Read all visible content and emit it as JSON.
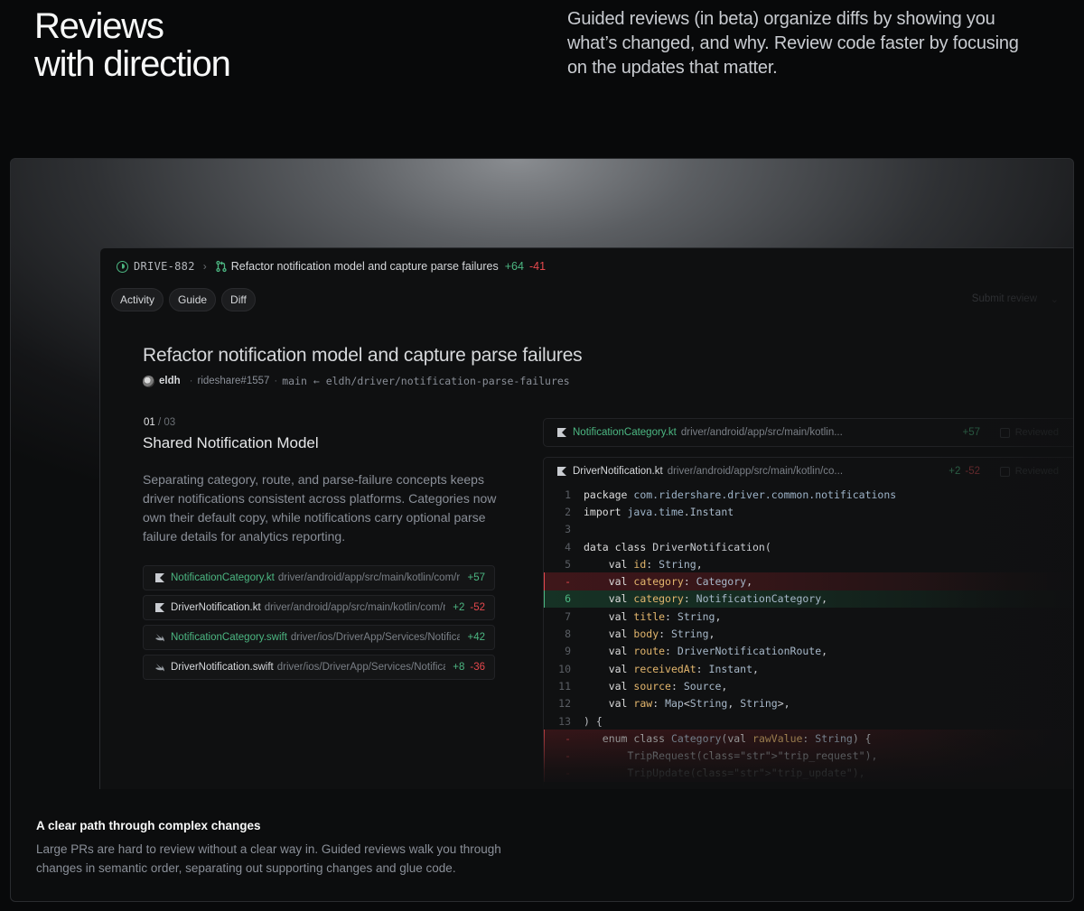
{
  "hero": {
    "title_line1": "Reviews",
    "title_line2": "with direction",
    "description": "Guided reviews (in beta) organize diffs by showing you what’s changed, and why. Review code faster by focusing on the updates that matter."
  },
  "app": {
    "topbar": {
      "issue_id": "DRIVE-882",
      "pr_title": "Refactor notification model and capture parse failures",
      "additions": "+64",
      "deletions": "-41"
    },
    "tabs": [
      "Activity",
      "Guide",
      "Diff"
    ],
    "submit_label": "Submit review",
    "heading": "Refactor notification model and capture parse failures",
    "meta": {
      "author": "eldh",
      "repo_ref": "rideshare#1557",
      "branch": "main ← eldh/driver/notification-parse-failures"
    },
    "step": {
      "current": "01",
      "total": "/ 03",
      "title": "Shared Notification Model",
      "description": "Separating category, route, and parse-failure concepts keeps driver notifications consistent across platforms. Categories now own their default copy, while notifications carry optional parse failure details for analytics reporting."
    },
    "files": [
      {
        "name": "NotificationCategory.kt",
        "path": "driver/android/app/src/main/kotlin/com/ridershare/driver/common/notifications",
        "add": "+57",
        "del": "",
        "new": true,
        "lang": "kotlin"
      },
      {
        "name": "DriverNotification.kt",
        "path": "driver/android/app/src/main/kotlin/com/ridershare/driver/common/notifications",
        "add": "+2",
        "del": "-52",
        "new": false,
        "lang": "kotlin"
      },
      {
        "name": "NotificationCategory.swift",
        "path": "driver/ios/DriverApp/Services/Notifications",
        "add": "+42",
        "del": "",
        "new": true,
        "lang": "swift"
      },
      {
        "name": "DriverNotification.swift",
        "path": "driver/ios/DriverApp/Services/Notifications",
        "add": "+8",
        "del": "-36",
        "new": false,
        "lang": "swift"
      }
    ],
    "panels": [
      {
        "name": "NotificationCategory.kt",
        "path": "driver/android/app/src/main/kotlin...",
        "add": "+57",
        "del": "",
        "reviewed_label": "Reviewed",
        "new": true
      },
      {
        "name": "DriverNotification.kt",
        "path": "driver/android/app/src/main/kotlin/co...",
        "add": "+2",
        "del": "-52",
        "reviewed_label": "Reviewed",
        "new": false
      }
    ],
    "code_lines": [
      {
        "n": "1",
        "type": "ctx",
        "text": "package com.ridershare.driver.common.notifications"
      },
      {
        "n": "2",
        "type": "ctx",
        "text": "import java.time.Instant"
      },
      {
        "n": "3",
        "type": "ctx",
        "text": ""
      },
      {
        "n": "4",
        "type": "ctx",
        "text": "data class DriverNotification("
      },
      {
        "n": "5",
        "type": "ctx",
        "text": "    val id: String,"
      },
      {
        "n": "-",
        "type": "del",
        "text": "    val category: Category,"
      },
      {
        "n": "6",
        "type": "add",
        "text": "    val category: NotificationCategory,"
      },
      {
        "n": "7",
        "type": "ctx",
        "text": "    val title: String,"
      },
      {
        "n": "8",
        "type": "ctx",
        "text": "    val body: String,"
      },
      {
        "n": "9",
        "type": "ctx",
        "text": "    val route: DriverNotificationRoute,"
      },
      {
        "n": "10",
        "type": "ctx",
        "text": "    val receivedAt: Instant,"
      },
      {
        "n": "11",
        "type": "ctx",
        "text": "    val source: Source,"
      },
      {
        "n": "12",
        "type": "ctx",
        "text": "    val raw: Map<String, String>,"
      },
      {
        "n": "13",
        "type": "ctx",
        "text": ") {"
      },
      {
        "n": "-",
        "type": "del",
        "text": "   enum class Category(val rawValue: String) {"
      },
      {
        "n": "-",
        "type": "del",
        "text": "       TripRequest(\"trip_request\"),"
      },
      {
        "n": "-",
        "type": "del",
        "text": "       TripUpdate(\"trip_update\"),"
      }
    ]
  },
  "caption": {
    "title": "A clear path through complex changes",
    "body": "Large PRs are hard to review without a clear way in. Guided reviews walk you through changes in semantic order, separating out supporting changes and glue code."
  },
  "colors": {
    "addition": "#4cb782",
    "deletion": "#e5484d",
    "background": "#08090a"
  }
}
